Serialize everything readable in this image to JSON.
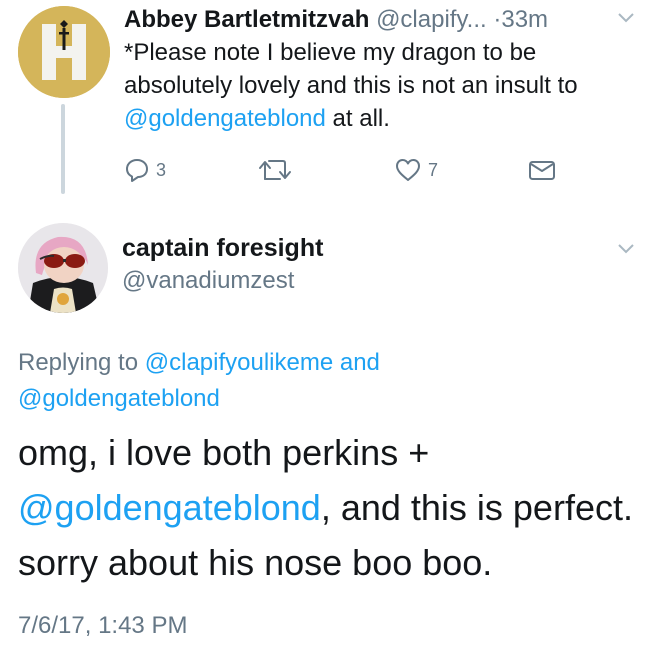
{
  "parent_tweet": {
    "name": "Abbey Bartletmitzvah",
    "handle": "@clapify...",
    "time": "·33m",
    "text_before": "*Please note I believe my dragon to be absolutely lovely and this is not an insult to ",
    "mention": "@goldengateblond",
    "text_after": " at all.",
    "reply_count": "3",
    "retweet_count": "",
    "like_count": "7",
    "icons": [
      "reply-icon",
      "retweet-icon",
      "like-icon",
      "direct-message-icon",
      "chevron-down-icon"
    ]
  },
  "reply_tweet": {
    "name": "captain foresight",
    "handle": "@vanadiumzest",
    "replying_prefix": "Replying to ",
    "replying_user_1": "@clapifyoulikeme",
    "replying_and": " and",
    "replying_user_2": "@goldengateblond",
    "text_before": "omg, i love both perkins +",
    "mention": "@goldengateblond",
    "text_after": ", and this is perfect. sorry about his nose boo boo.",
    "date": "7/6/17, 1:43 PM"
  },
  "colors": {
    "link": "#1da1f2",
    "secondary": "#657786",
    "thread_line": "#ccd6dd",
    "avatar1_bg": "#d4b55a"
  }
}
